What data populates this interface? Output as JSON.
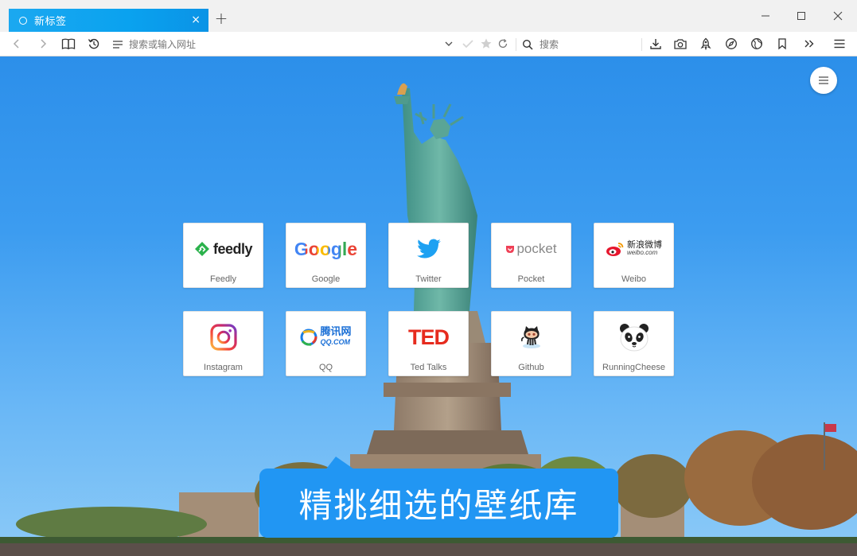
{
  "tab": {
    "title": "新标签",
    "close": "×"
  },
  "new_tab": "+",
  "toolbar": {
    "address_placeholder": "搜索或输入网址",
    "search_placeholder": "搜索"
  },
  "speed_dial": [
    {
      "label": "Feedly",
      "logo_text": "feedly"
    },
    {
      "label": "Google",
      "logo_text": "Google"
    },
    {
      "label": "Twitter"
    },
    {
      "label": "Pocket",
      "logo_text": "pocket"
    },
    {
      "label": "Weibo",
      "logo_text": "新浪微博",
      "logo_sub": "weibo.com"
    },
    {
      "label": "Instagram"
    },
    {
      "label": "QQ",
      "logo_text": "腾讯网",
      "logo_sub": "QQ.COM"
    },
    {
      "label": "Ted Talks",
      "logo_text": "TED"
    },
    {
      "label": "Github"
    },
    {
      "label": "RunningCheese"
    }
  ],
  "promo": {
    "text": "精挑细选的壁纸库"
  },
  "colors": {
    "tab_accent": "#0aa2ef",
    "promo_blue": "#2196f3",
    "feedly_green": "#2bb24c",
    "twitter_blue": "#1da1f2",
    "pocket_red": "#ef4056",
    "ted_red": "#e62b1e"
  }
}
